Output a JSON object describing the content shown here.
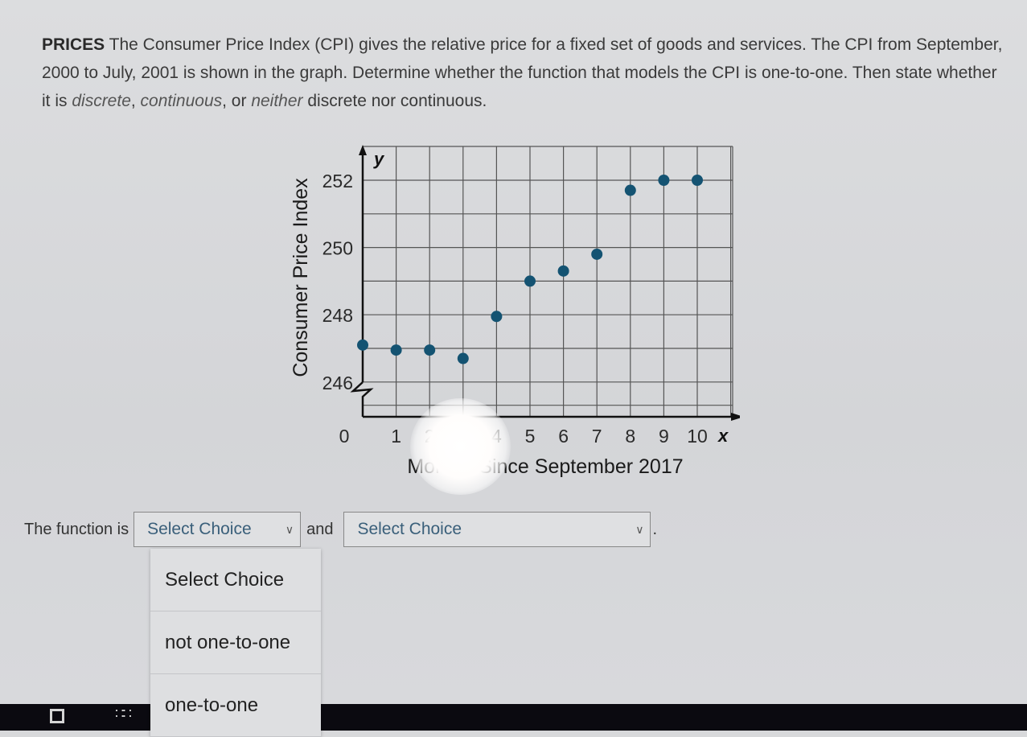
{
  "question": {
    "lead": "PRICES",
    "text_1": " The Consumer Price Index (CPI) gives the relative price for a fixed set of goods and services. The CPI from September, 2000 to July, 2001 is shown in the graph. Determine whether the function that models the CPI is one-to-one. Then state whether it is ",
    "em_discrete": "discrete",
    "sep_1": ", ",
    "em_continuous": "continuous",
    "sep_2": ", or ",
    "em_neither": "neither",
    "text_2": " discrete nor continuous."
  },
  "answer": {
    "prefix": "The function is",
    "select1_value": "Select Choice",
    "joiner": "and",
    "select2_value": "Select Choice",
    "suffix": ".",
    "chevron_icon": "chevron-down-icon",
    "chevron_glyph": "∨"
  },
  "dropdown": {
    "options": [
      "Select Choice",
      "not one-to-one",
      "one-to-one"
    ]
  },
  "taskbar": {
    "icons": [
      "task-view-icon",
      "app-launcher-icon",
      "chrome-icon"
    ],
    "grid_glyph": "∷∷"
  },
  "chart_data": {
    "type": "scatter",
    "title": "",
    "xlabel": "Months Since September 2017",
    "ylabel": "Consumer Price Index",
    "x_axis_var": "x",
    "y_axis_var": "y",
    "xlim": [
      0,
      10
    ],
    "ylim": [
      245.5,
      252.5
    ],
    "x_ticks": [
      0,
      1,
      2,
      3,
      4,
      5,
      6,
      7,
      8,
      9,
      10
    ],
    "x_tick_labels": [
      "0",
      "1",
      "2",
      "",
      "4",
      "5",
      "6",
      "7",
      "8",
      "9",
      "10"
    ],
    "y_ticks": [
      246,
      248,
      250,
      252
    ],
    "y_tick_labels": [
      "246",
      "248",
      "250",
      "252"
    ],
    "y_axis_break": true,
    "grid": true,
    "grid_y_step": 1,
    "grid_x_step": 1,
    "point_color": "#145372",
    "x": [
      0,
      1,
      2,
      3,
      4,
      5,
      6,
      7,
      8,
      9,
      10
    ],
    "y": [
      247.1,
      246.95,
      246.95,
      246.7,
      247.95,
      249.0,
      249.3,
      249.8,
      251.7,
      252.0,
      252.0
    ]
  }
}
